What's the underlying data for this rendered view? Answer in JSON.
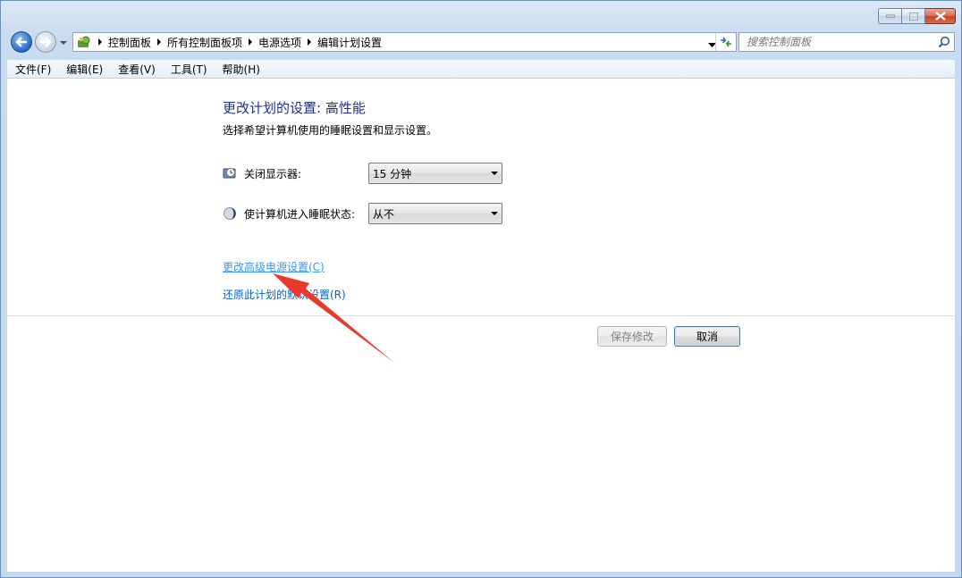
{
  "window": {
    "breadcrumb": [
      "控制面板",
      "所有控制面板项",
      "电源选项",
      "编辑计划设置"
    ]
  },
  "search": {
    "placeholder": "搜索控制面板"
  },
  "menu": [
    {
      "label": "文件(F)"
    },
    {
      "label": "编辑(E)"
    },
    {
      "label": "查看(V)"
    },
    {
      "label": "工具(T)"
    },
    {
      "label": "帮助(H)"
    }
  ],
  "content": {
    "title": "更改计划的设置: 高性能",
    "subtitle": "选择希望计算机使用的睡眠设置和显示设置。",
    "display_label": "关闭显示器:",
    "display_value": "15 分钟",
    "sleep_label": "使计算机进入睡眠状态:",
    "sleep_value": "从不",
    "advanced_link": "更改高级电源设置(C)",
    "restore_link": "还原此计划的默认设置(R)"
  },
  "buttons": {
    "save": "保存修改",
    "cancel": "取消"
  },
  "colors": {
    "title": "#1e3287",
    "link": "#0066cc",
    "annotation_arrow": "#e8392c"
  }
}
